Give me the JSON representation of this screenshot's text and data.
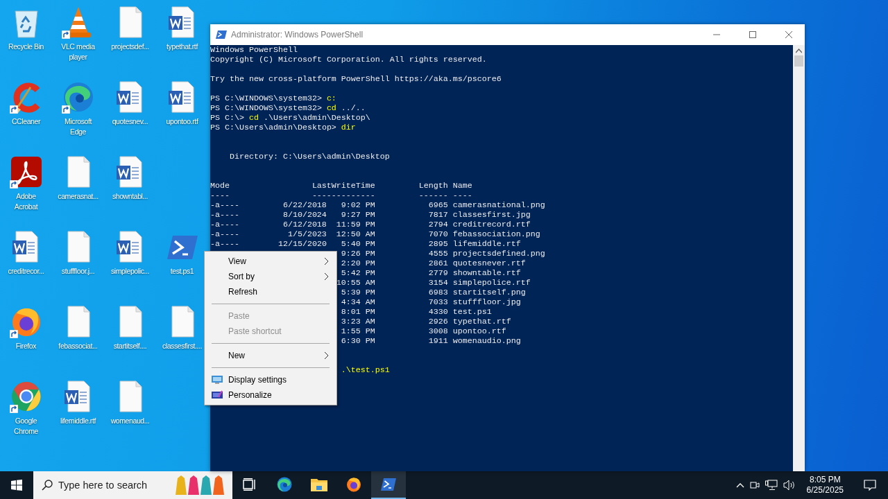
{
  "desktop": {
    "columns": [
      [
        {
          "label": "Recycle Bin",
          "kind": "recycle",
          "shortcut": false
        },
        {
          "label": "CCleaner",
          "kind": "ccleaner",
          "shortcut": true
        },
        {
          "label": "Adobe Acrobat",
          "kind": "acrobat",
          "shortcut": true
        },
        {
          "label": "creditrecor...",
          "kind": "word",
          "shortcut": false
        },
        {
          "label": "Firefox",
          "kind": "firefox",
          "shortcut": true
        },
        {
          "label": "Google Chrome",
          "kind": "chrome",
          "shortcut": true
        }
      ],
      [
        {
          "label": "VLC media player",
          "kind": "vlc",
          "shortcut": true
        },
        {
          "label": "Microsoft Edge",
          "kind": "edge",
          "shortcut": true
        },
        {
          "label": "camerasnat...",
          "kind": "file",
          "shortcut": false
        },
        {
          "label": "stufffloor.j...",
          "kind": "file",
          "shortcut": false
        },
        {
          "label": "febassociat...",
          "kind": "file",
          "shortcut": false
        },
        {
          "label": "lifemiddle.rtf",
          "kind": "word",
          "shortcut": false
        }
      ],
      [
        {
          "label": "projectsdef...",
          "kind": "file",
          "shortcut": false
        },
        {
          "label": "quotesnev...",
          "kind": "word",
          "shortcut": false
        },
        {
          "label": "showntabl...",
          "kind": "word",
          "shortcut": false
        },
        {
          "label": "simplepolic...",
          "kind": "word",
          "shortcut": false
        },
        {
          "label": "startitself....",
          "kind": "file",
          "shortcut": false
        },
        {
          "label": "womenaud...",
          "kind": "file",
          "shortcut": false
        }
      ],
      [
        {
          "label": "typethat.rtf",
          "kind": "word",
          "shortcut": false
        },
        {
          "label": "upontoo.rtf",
          "kind": "word",
          "shortcut": false
        },
        null,
        {
          "label": "test.ps1",
          "kind": "powershell",
          "shortcut": false
        },
        {
          "label": "classesfirst....",
          "kind": "file",
          "shortcut": false
        }
      ]
    ]
  },
  "window": {
    "title": "Administrator: Windows PowerShell",
    "console": {
      "lines": [
        {
          "kind": "output",
          "text": "Windows PowerShell"
        },
        {
          "kind": "output",
          "text": "Copyright (C) Microsoft Corporation. All rights reserved."
        },
        {
          "kind": "blank"
        },
        {
          "kind": "output",
          "text": "Try the new cross-platform PowerShell https://aka.ms/pscore6"
        },
        {
          "kind": "blank"
        },
        {
          "kind": "prompt",
          "prompt": "PS C:\\WINDOWS\\system32>",
          "command": "c:"
        },
        {
          "kind": "prompt",
          "prompt": "PS C:\\WINDOWS\\system32>",
          "command": "cd",
          "args": "../.."
        },
        {
          "kind": "prompt",
          "prompt": "PS C:\\>",
          "command": "cd",
          "args": ".\\Users\\admin\\Desktop\\"
        },
        {
          "kind": "prompt",
          "prompt": "PS C:\\Users\\admin\\Desktop>",
          "command": "dir"
        },
        {
          "kind": "blank"
        },
        {
          "kind": "blank"
        },
        {
          "kind": "heading",
          "text": "Directory: C:\\Users\\admin\\Desktop"
        },
        {
          "kind": "blank"
        },
        {
          "kind": "blank"
        }
      ],
      "listing": {
        "header": {
          "mode": "Mode",
          "time": "LastWriteTime",
          "length": "Length",
          "name": "Name"
        },
        "rule": {
          "mode": "----",
          "time": "-------------",
          "length": "------",
          "name": "----"
        },
        "rows": [
          {
            "mode": "-a----",
            "date": "6/22/2018",
            "time": "9:02 PM",
            "length": "6965",
            "name": "camerasnational.png"
          },
          {
            "mode": "-a----",
            "date": "8/10/2024",
            "time": "9:27 PM",
            "length": "7817",
            "name": "classesfirst.jpg"
          },
          {
            "mode": "-a----",
            "date": "6/12/2018",
            "time": "11:59 PM",
            "length": "2794",
            "name": "creditrecord.rtf"
          },
          {
            "mode": "-a----",
            "date": "1/5/2023",
            "time": "12:50 AM",
            "length": "7070",
            "name": "febassociation.png"
          },
          {
            "mode": "-a----",
            "date": "12/15/2020",
            "time": "5:40 PM",
            "length": "2895",
            "name": "lifemiddle.rtf"
          },
          {
            "time": "9:26 PM",
            "length": "4555",
            "name": "projectsdefined.png"
          },
          {
            "time": "2:20 PM",
            "length": "2861",
            "name": "quotesnever.rtf"
          },
          {
            "time": "5:42 PM",
            "length": "2779",
            "name": "showntable.rtf"
          },
          {
            "time": "10:55 AM",
            "length": "3154",
            "name": "simplepolice.rtf"
          },
          {
            "time": "5:39 PM",
            "length": "6983",
            "name": "startitself.png"
          },
          {
            "time": "4:34 AM",
            "length": "7033",
            "name": "stufffloor.jpg"
          },
          {
            "time": "8:01 PM",
            "length": "4330",
            "name": "test.ps1"
          },
          {
            "time": "3:23 AM",
            "length": "2926",
            "name": "typethat.rtf"
          },
          {
            "time": "1:55 PM",
            "length": "3008",
            "name": "upontoo.rtf"
          },
          {
            "time": "6:30 PM",
            "length": "1911",
            "name": "womenaudio.png"
          }
        ]
      },
      "tail": [
        {
          "kind": "blank"
        },
        {
          "kind": "blank"
        },
        {
          "kind": "command_tail",
          "command": ".\\test.ps1"
        }
      ]
    }
  },
  "context_menu": {
    "items": [
      {
        "kind": "submenu",
        "label": "View",
        "disabled": false
      },
      {
        "kind": "submenu",
        "label": "Sort by",
        "disabled": false
      },
      {
        "kind": "action",
        "label": "Refresh",
        "disabled": false
      },
      {
        "kind": "separator"
      },
      {
        "kind": "action",
        "label": "Paste",
        "disabled": true
      },
      {
        "kind": "action",
        "label": "Paste shortcut",
        "disabled": true
      },
      {
        "kind": "separator"
      },
      {
        "kind": "submenu",
        "label": "New",
        "disabled": false
      },
      {
        "kind": "separator"
      },
      {
        "kind": "display",
        "label": "Display settings",
        "disabled": false
      },
      {
        "kind": "personalize",
        "label": "Personalize",
        "disabled": false
      }
    ]
  },
  "taskbar": {
    "search": {
      "placeholder": "Type here to search"
    },
    "apps": [
      {
        "kind": "task_view",
        "running": false
      },
      {
        "kind": "edge",
        "running": false
      },
      {
        "kind": "explorer",
        "running": false
      },
      {
        "kind": "firefox",
        "running": false
      },
      {
        "kind": "powershell",
        "running": true
      }
    ],
    "clock": {
      "time": "8:05 PM",
      "date": "6/25/2025"
    }
  }
}
